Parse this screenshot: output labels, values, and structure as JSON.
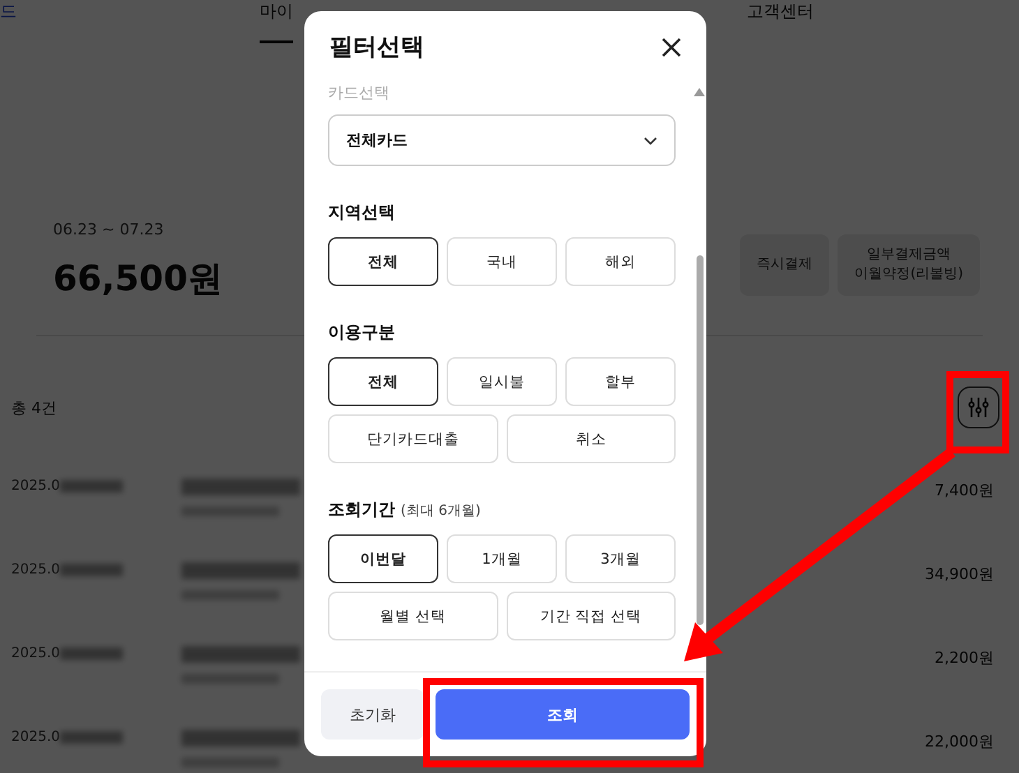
{
  "background_page": {
    "nav_partial": "드",
    "nav": [
      {
        "label": "마이",
        "selected": true
      },
      {
        "label": "고객센터",
        "selected": false
      }
    ],
    "period": "06.23 ~ 07.23",
    "total": "66,500원",
    "actions": [
      {
        "lines": [
          "즉시결제"
        ]
      },
      {
        "lines": [
          "일부결제금액",
          "이월약정(리볼빙)"
        ]
      }
    ],
    "count": "총 4건",
    "rows": [
      {
        "date": "2025.0",
        "amount": "7,400원"
      },
      {
        "date": "2025.0",
        "amount": "34,900원"
      },
      {
        "date": "2025.0",
        "amount": "2,200원"
      },
      {
        "date": "2025.0",
        "amount": "22,000원"
      }
    ]
  },
  "modal": {
    "title": "필터선택",
    "card_section": {
      "label": "카드선택",
      "value": "전체카드"
    },
    "sections": [
      {
        "title": "지역선택",
        "options": [
          {
            "label": "전체",
            "selected": true
          },
          {
            "label": "국내",
            "selected": false
          },
          {
            "label": "해외",
            "selected": false
          }
        ]
      },
      {
        "title": "이용구분",
        "options": [
          {
            "label": "전체",
            "selected": true
          },
          {
            "label": "일시불",
            "selected": false
          },
          {
            "label": "할부",
            "selected": false
          },
          {
            "label": "단기카드대출",
            "selected": false
          },
          {
            "label": "취소",
            "selected": false
          }
        ]
      },
      {
        "title": "조회기간",
        "note": "(최대 6개월)",
        "options": [
          {
            "label": "이번달",
            "selected": true
          },
          {
            "label": "1개월",
            "selected": false
          },
          {
            "label": "3개월",
            "selected": false
          },
          {
            "label": "월별 선택",
            "selected": false
          },
          {
            "label": "기간 직접 선택",
            "selected": false
          }
        ]
      }
    ],
    "reset": "초기화",
    "submit": "조회"
  }
}
